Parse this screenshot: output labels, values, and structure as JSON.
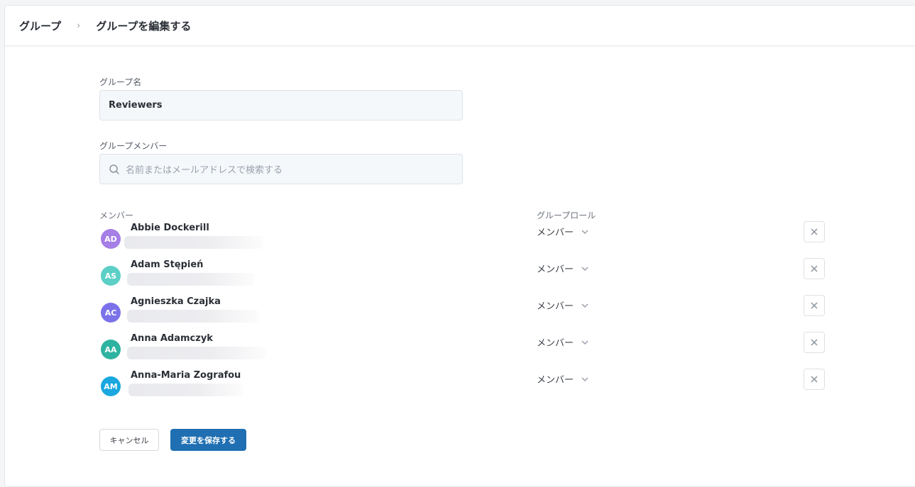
{
  "breadcrumb": {
    "parent": "グループ",
    "separator": "›",
    "current": "グループを編集する"
  },
  "form": {
    "group_name_label": "グループ名",
    "group_name_value": "Reviewers",
    "members_label": "グループメンバー",
    "search_placeholder": "名前またはメールアドレスで検索する"
  },
  "table": {
    "col_member": "メンバー",
    "col_role": "グループロール",
    "rows": [
      {
        "initials": "AD",
        "name": "Abbie Dockerill",
        "role": "メンバー",
        "avatar_color": "#a57ee6"
      },
      {
        "initials": "AS",
        "name": "Adam Stępień",
        "role": "メンバー",
        "avatar_color": "#5ccfc6"
      },
      {
        "initials": "AC",
        "name": "Agnieszka Czajka",
        "role": "メンバー",
        "avatar_color": "#7b72e9"
      },
      {
        "initials": "AA",
        "name": "Anna Adamczyk",
        "role": "メンバー",
        "avatar_color": "#2fb3a1"
      },
      {
        "initials": "AM",
        "name": "Anna-Maria Zografou",
        "role": "メンバー",
        "avatar_color": "#1aa7e0"
      }
    ]
  },
  "actions": {
    "cancel_label": "キャンセル",
    "save_label": "変更を保存する"
  },
  "colors": {
    "primary": "#1f6fb2"
  }
}
